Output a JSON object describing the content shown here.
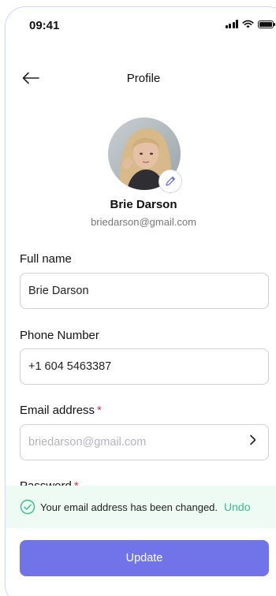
{
  "status_bar": {
    "time": "09:41",
    "icons": [
      "signal-icon",
      "wifi-icon",
      "battery-icon"
    ]
  },
  "header": {
    "back_icon": "arrow-left-icon",
    "title": "Profile"
  },
  "profile": {
    "name": "Brie Darson",
    "email": "briedarson@gmail.com",
    "avatar_icon": "avatar-photo",
    "edit_icon": "pencil-icon"
  },
  "form": {
    "full_name": {
      "label": "Full name",
      "value": "Brie Darson"
    },
    "phone": {
      "label": "Phone Number",
      "value": "+1 604 5463387"
    },
    "email": {
      "label": "Email address",
      "required_mark": "*",
      "placeholder": "briedarson@gmail.com",
      "icon": "chevron-right-icon"
    },
    "password": {
      "label": "Password",
      "required_mark": "*"
    }
  },
  "toast": {
    "icon": "check-circle-icon",
    "message": "Your email address has been changed.",
    "action": "Undo"
  },
  "actions": {
    "update_label": "Update"
  },
  "colors": {
    "accent": "#7173e8",
    "success": "#3dbb8a",
    "toast_bg": "#eefaf4",
    "required": "#e0313f"
  }
}
